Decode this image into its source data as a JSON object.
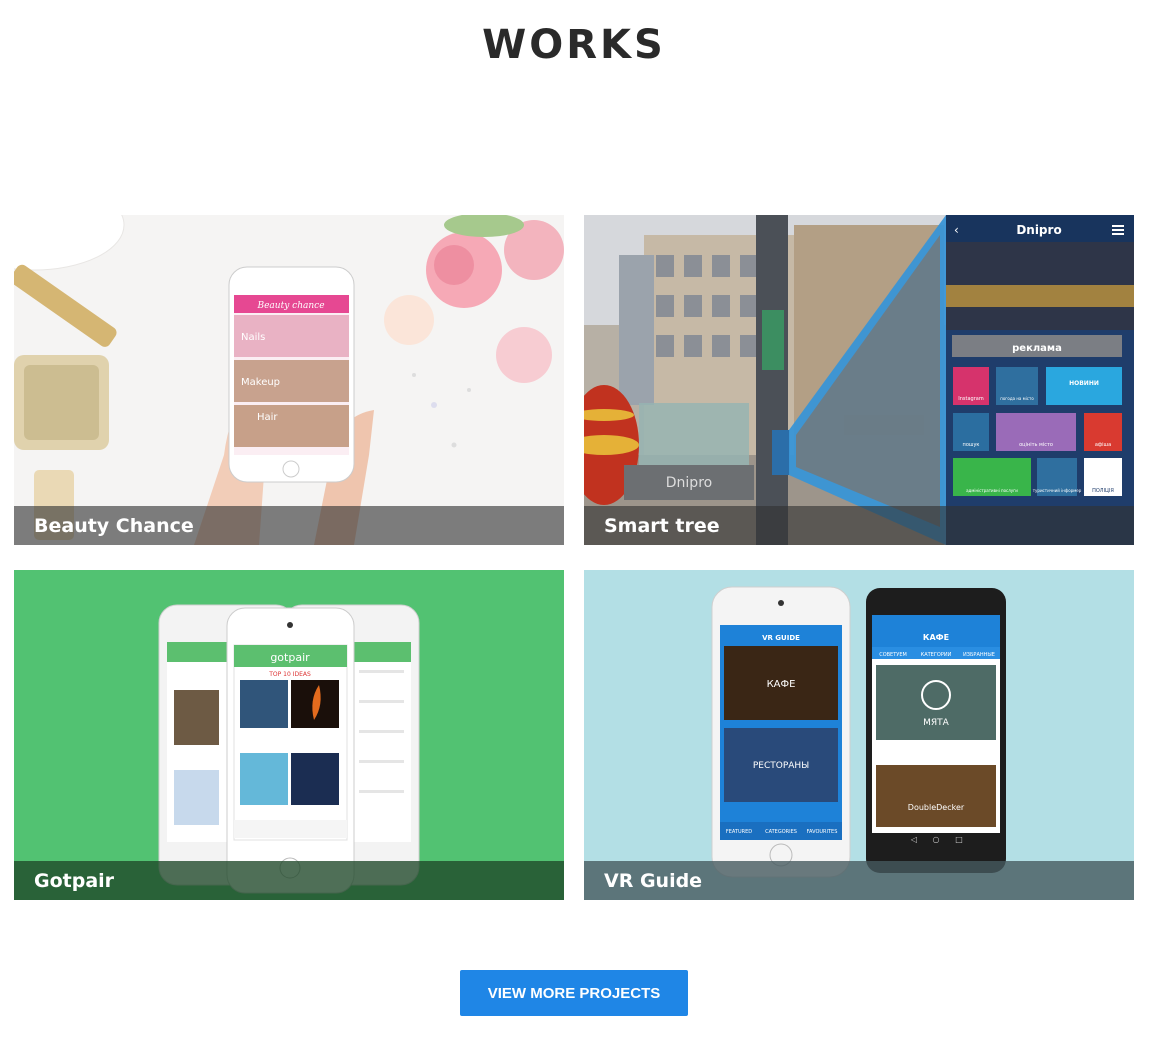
{
  "section": {
    "title": "WORKS"
  },
  "projects": [
    {
      "name": "Beauty Chance",
      "screen_title": "Beauty chance",
      "menu": [
        "Nails",
        "Makeup",
        "Hair"
      ]
    },
    {
      "name": "Smart tree",
      "screen_title": "Dnipro",
      "ad_label": "реклама",
      "sign": "Dnipro",
      "tiles": [
        "Instagram",
        "погода на місто",
        "НОВИНИ",
        "пошук",
        "оцініть місто",
        "афіша",
        "адміністративні послуги",
        "туристичний інформер",
        "ПОЛІЦІЯ"
      ]
    },
    {
      "name": "Gotpair",
      "app_title": "gotpair",
      "banner": "TOP 10 IDEAS"
    },
    {
      "name": "VR Guide",
      "left_title": "VR GUIDE",
      "left_items": [
        "КАФЕ",
        "РЕСТОРАНЫ"
      ],
      "left_tabs": [
        "FEATURED",
        "CATEGORIES",
        "FAVOURITES"
      ],
      "right_title": "КАФЕ",
      "right_tabs": [
        "СОВЕТУЕМ",
        "КАТЕГОРИИ",
        "ИЗБРАННЫЕ"
      ],
      "right_items": [
        "МЯТА",
        "DoubleDecker"
      ]
    }
  ],
  "cta": {
    "label": "VIEW MORE PROJECTS"
  },
  "colors": {
    "accent": "#1f86e6",
    "gotpair_bg": "#52c272",
    "vr_bg": "#b3dfe5"
  }
}
